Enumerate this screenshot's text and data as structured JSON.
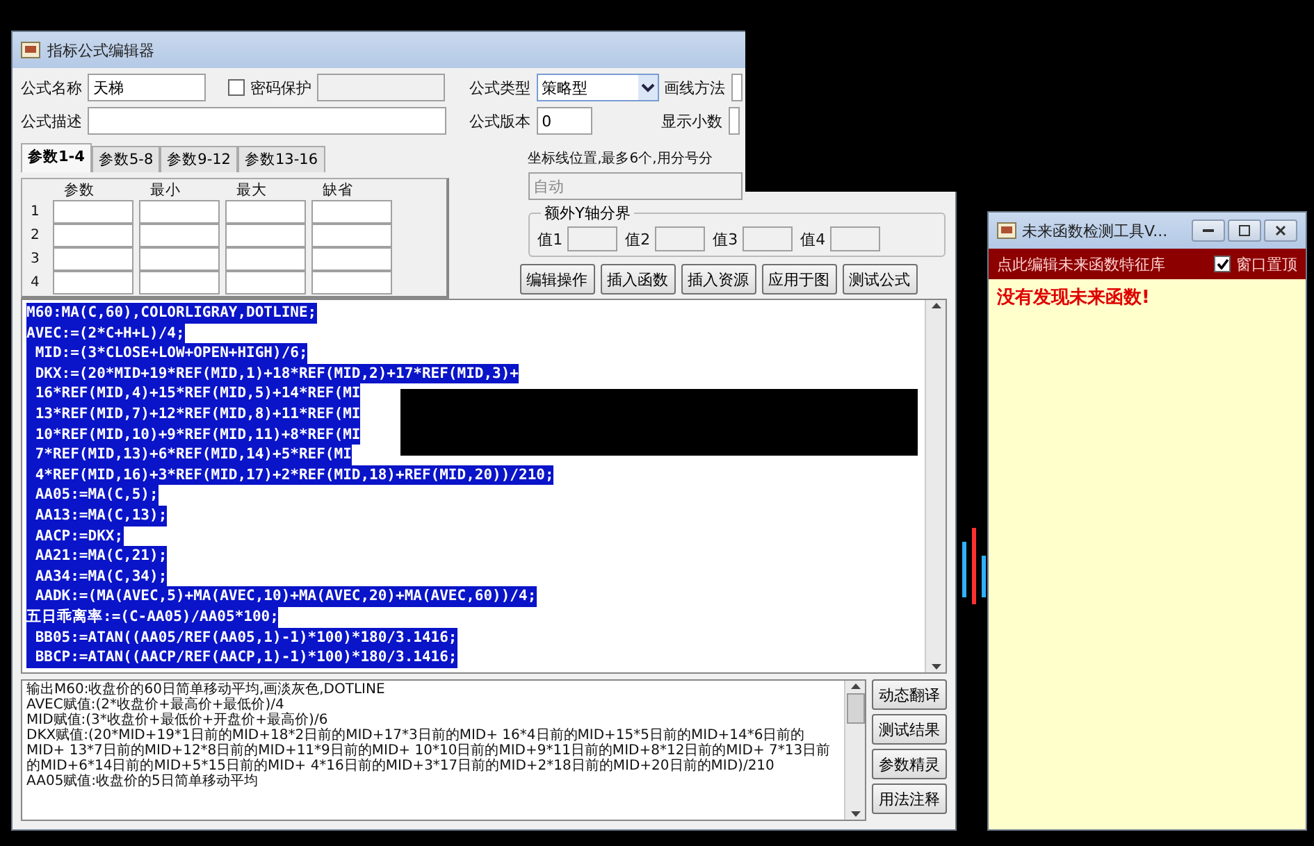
{
  "editor": {
    "title": "指标公式编辑器",
    "name": {
      "label": "公式名称",
      "value": "天梯"
    },
    "password": {
      "label": "密码保护",
      "checked": false
    },
    "description": {
      "label": "公式描述"
    },
    "type": {
      "label": "公式类型",
      "value": "策略型"
    },
    "draw_method": {
      "label": "画线方法"
    },
    "version": {
      "label": "公式版本",
      "value": "0"
    },
    "decimals": {
      "label": "显示小数"
    },
    "tabs": [
      {
        "label": "参数1-4",
        "selected": true
      },
      {
        "label": "参数5-8",
        "selected": false
      },
      {
        "label": "参数9-12",
        "selected": false
      },
      {
        "label": "参数13-16",
        "selected": false
      }
    ],
    "params": {
      "columns": [
        "参数",
        "最小",
        "最大",
        "缺省"
      ],
      "rows": [
        "1",
        "2",
        "3",
        "4"
      ]
    },
    "axis_hint": "坐标线位置,最多6个,用分号分",
    "axis_value": "自动",
    "y_group": {
      "title": "额外Y轴分界",
      "fields": [
        "值1",
        "值2",
        "值3",
        "值4"
      ]
    },
    "buttons": [
      "编辑操作",
      "插入函数",
      "插入资源",
      "应用于图",
      "测试公式"
    ],
    "code": [
      {
        "text": "M60:MA(C,60),COLORLIGRAY,DOTLINE;",
        "selected": true
      },
      {
        "text": "AVEC:=(2*C+H+L)/4;",
        "selected": true
      },
      {
        "text": " MID:=(3*CLOSE+LOW+OPEN+HIGH)/6;",
        "selected": true
      },
      {
        "text": " DKX:=(20*MID+19*REF(MID,1)+18*REF(MID,2)+17*REF(MID,3)+",
        "selected": true
      },
      {
        "text": " 16*REF(MID,4)+15*REF(MID,5)+14*REF(MI",
        "selected": true
      },
      {
        "text": " 13*REF(MID,7)+12*REF(MID,8)+11*REF(MI",
        "selected": true
      },
      {
        "text": " 10*REF(MID,10)+9*REF(MID,11)+8*REF(MI",
        "selected": true
      },
      {
        "text": " 7*REF(MID,13)+6*REF(MID,14)+5*REF(MI",
        "selected": true
      },
      {
        "text": " 4*REF(MID,16)+3*REF(MID,17)+2*REF(MID,18)+REF(MID,20))/210;",
        "selected": true
      },
      {
        "text": " AA05:=MA(C,5);",
        "selected": true
      },
      {
        "text": " AA13:=MA(C,13);",
        "selected": true
      },
      {
        "text": " AACP:=DKX;",
        "selected": true
      },
      {
        "text": " AA21:=MA(C,21);",
        "selected": true
      },
      {
        "text": " AA34:=MA(C,34);",
        "selected": true
      },
      {
        "text": " AADK:=(MA(AVEC,5)+MA(AVEC,10)+MA(AVEC,20)+MA(AVEC,60))/4;",
        "selected": true
      },
      {
        "text": "五日乖离率:=(C-AA05)/AA05*100;",
        "selected": true
      },
      {
        "text": " BB05:=ATAN((AA05/REF(AA05,1)-1)*100)*180/3.1416;",
        "selected": true
      },
      {
        "text": " BBCP:=ATAN((AACP/REF(AACP,1)-1)*100)*180/3.1416;",
        "selected": true
      }
    ],
    "output": [
      "输出M60:收盘价的60日简单移动平均,画淡灰色,DOTLINE",
      "AVEC赋值:(2*收盘价+最高价+最低价)/4",
      "MID赋值:(3*收盘价+最低价+开盘价+最高价)/6",
      "DKX赋值:(20*MID+19*1日前的MID+18*2日前的MID+17*3日前的MID+ 16*4日前的MID+15*5日前的MID+14*6日前的MID+ 13*7日前的MID+12*8日前的MID+11*9日前的MID+ 10*10日前的MID+9*11日前的MID+8*12日前的MID+ 7*13日前的MID+6*14日前的MID+5*15日前的MID+ 4*16日前的MID+3*17日前的MID+2*18日前的MID+20日前的MID)/210",
      "AA05赋值:收盘价的5日简单移动平均"
    ],
    "side_buttons": [
      "动态翻译",
      "测试结果",
      "参数精灵",
      "用法注释"
    ]
  },
  "checker": {
    "title": "未来函数检测工具V...",
    "edit_link": "点此编辑未来函数特征库",
    "topmost": {
      "label": "窗口置顶",
      "checked": true
    },
    "result": "没有发现未来函数!"
  }
}
